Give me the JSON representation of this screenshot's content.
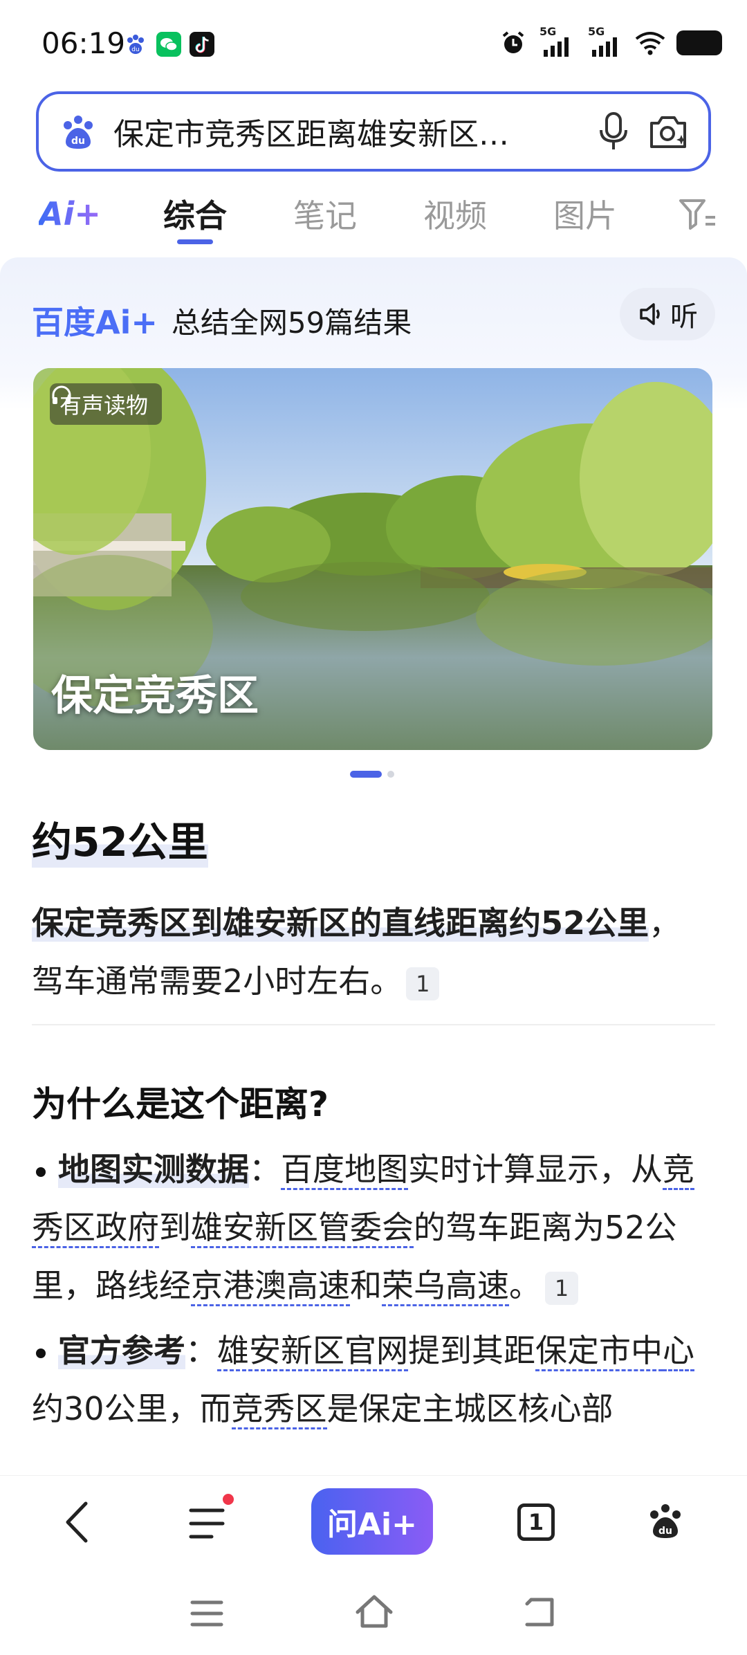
{
  "status_bar": {
    "time": "06:19",
    "app_icons": [
      "baidu-icon",
      "wechat-icon",
      "douyin-icon"
    ],
    "signal_labels": [
      "5G",
      "5G"
    ]
  },
  "search": {
    "query": "保定市竞秀区距离雄安新区…",
    "icons": [
      "baidu-paw-icon",
      "microphone-icon",
      "camera-search-icon"
    ]
  },
  "tabs": {
    "ai_label": "Ai+",
    "items": [
      "综合",
      "笔记",
      "视频",
      "图片"
    ],
    "active": "综合",
    "filter_icon": "filter-icon"
  },
  "ai_panel": {
    "brand": "百度Ai+",
    "summary": "总结全网59篇结果",
    "listen_label": "听",
    "image": {
      "badge": "有声读物",
      "caption": "保定竞秀区"
    },
    "answer_title": "约52公里",
    "answer_para_highlight": "保定竞秀区到雄安新区的直线距离约52公里",
    "answer_para_rest_1": "，",
    "answer_para_rest_2": "驾车通常需要2小时左右。",
    "answer_ref": "1",
    "why_title": "为什么是这个距离?",
    "bullets": [
      {
        "label": "地图实测数据",
        "sep": "：",
        "segments": [
          "百度地图",
          "实时计算显示，从",
          "竞秀区政府",
          "到",
          "雄安新区管委会",
          "的驾车距离为52",
          "公里，路线经",
          "京港澳高速",
          "和",
          "荣乌高速",
          "。"
        ],
        "ref": "1"
      },
      {
        "label": "官方参考",
        "sep": "：",
        "segments": [
          "雄安新区官网",
          "提到其距",
          "保定市中",
          "心",
          "约30公里，而",
          "竞秀区",
          "是保定主城区核心部"
        ]
      }
    ]
  },
  "bottom_bar": {
    "ask_ai_label": "问Ai+",
    "tab_count": "1"
  },
  "colors": {
    "accent": "#4b63e6",
    "ai_blue": "#4b6ef6",
    "notification_red": "#f0364a"
  }
}
